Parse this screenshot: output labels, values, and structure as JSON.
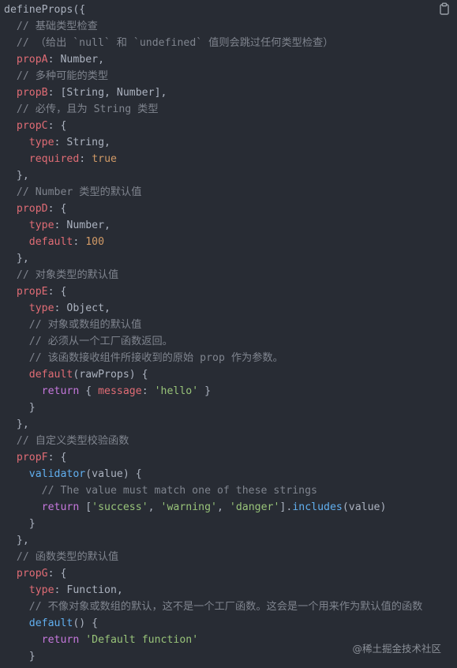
{
  "code": {
    "lines": [
      [
        {
          "t": "defineProps({",
          "c": "d"
        }
      ],
      [
        {
          "t": "  // 基础类型检查",
          "c": "c"
        }
      ],
      [
        {
          "t": "  // （给出 `null` 和 `undefined` 值则会跳过任何类型检查）",
          "c": "c"
        }
      ],
      [
        {
          "t": "  ",
          "c": "d"
        },
        {
          "t": "propA",
          "c": "p"
        },
        {
          "t": ": Number,",
          "c": "d"
        }
      ],
      [
        {
          "t": "  // 多种可能的类型",
          "c": "c"
        }
      ],
      [
        {
          "t": "  ",
          "c": "d"
        },
        {
          "t": "propB",
          "c": "p"
        },
        {
          "t": ": [String, Number],",
          "c": "d"
        }
      ],
      [
        {
          "t": "  // 必传，且为 String 类型",
          "c": "c"
        }
      ],
      [
        {
          "t": "  ",
          "c": "d"
        },
        {
          "t": "propC",
          "c": "p"
        },
        {
          "t": ": {",
          "c": "d"
        }
      ],
      [
        {
          "t": "    ",
          "c": "d"
        },
        {
          "t": "type",
          "c": "p"
        },
        {
          "t": ": String,",
          "c": "d"
        }
      ],
      [
        {
          "t": "    ",
          "c": "d"
        },
        {
          "t": "required",
          "c": "p"
        },
        {
          "t": ": ",
          "c": "d"
        },
        {
          "t": "true",
          "c": "n"
        }
      ],
      [
        {
          "t": "  },",
          "c": "d"
        }
      ],
      [
        {
          "t": "  // Number 类型的默认值",
          "c": "c"
        }
      ],
      [
        {
          "t": "  ",
          "c": "d"
        },
        {
          "t": "propD",
          "c": "p"
        },
        {
          "t": ": {",
          "c": "d"
        }
      ],
      [
        {
          "t": "    ",
          "c": "d"
        },
        {
          "t": "type",
          "c": "p"
        },
        {
          "t": ": Number,",
          "c": "d"
        }
      ],
      [
        {
          "t": "    ",
          "c": "d"
        },
        {
          "t": "default",
          "c": "p"
        },
        {
          "t": ": ",
          "c": "d"
        },
        {
          "t": "100",
          "c": "n"
        }
      ],
      [
        {
          "t": "  },",
          "c": "d"
        }
      ],
      [
        {
          "t": "  // 对象类型的默认值",
          "c": "c"
        }
      ],
      [
        {
          "t": "  ",
          "c": "d"
        },
        {
          "t": "propE",
          "c": "p"
        },
        {
          "t": ": {",
          "c": "d"
        }
      ],
      [
        {
          "t": "    ",
          "c": "d"
        },
        {
          "t": "type",
          "c": "p"
        },
        {
          "t": ": Object,",
          "c": "d"
        }
      ],
      [
        {
          "t": "    // 对象或数组的默认值",
          "c": "c"
        }
      ],
      [
        {
          "t": "    // 必须从一个工厂函数返回。",
          "c": "c"
        }
      ],
      [
        {
          "t": "    // 该函数接收组件所接收到的原始 prop 作为参数。",
          "c": "c"
        }
      ],
      [
        {
          "t": "    ",
          "c": "d"
        },
        {
          "t": "default",
          "c": "p"
        },
        {
          "t": "(rawProps) {",
          "c": "d"
        }
      ],
      [
        {
          "t": "      ",
          "c": "d"
        },
        {
          "t": "return",
          "c": "k"
        },
        {
          "t": " { ",
          "c": "d"
        },
        {
          "t": "message",
          "c": "p"
        },
        {
          "t": ": ",
          "c": "d"
        },
        {
          "t": "'hello'",
          "c": "s"
        },
        {
          "t": " }",
          "c": "d"
        }
      ],
      [
        {
          "t": "    }",
          "c": "d"
        }
      ],
      [
        {
          "t": "  },",
          "c": "d"
        }
      ],
      [
        {
          "t": "  // 自定义类型校验函数",
          "c": "c"
        }
      ],
      [
        {
          "t": "  ",
          "c": "d"
        },
        {
          "t": "propF",
          "c": "p"
        },
        {
          "t": ": {",
          "c": "d"
        }
      ],
      [
        {
          "t": "    ",
          "c": "d"
        },
        {
          "t": "validator",
          "c": "f"
        },
        {
          "t": "(value) {",
          "c": "d"
        }
      ],
      [
        {
          "t": "      // The value must match one of these strings",
          "c": "c"
        }
      ],
      [
        {
          "t": "      ",
          "c": "d"
        },
        {
          "t": "return",
          "c": "k"
        },
        {
          "t": " [",
          "c": "d"
        },
        {
          "t": "'success'",
          "c": "s"
        },
        {
          "t": ", ",
          "c": "d"
        },
        {
          "t": "'warning'",
          "c": "s"
        },
        {
          "t": ", ",
          "c": "d"
        },
        {
          "t": "'danger'",
          "c": "s"
        },
        {
          "t": "].",
          "c": "d"
        },
        {
          "t": "includes",
          "c": "f"
        },
        {
          "t": "(value)",
          "c": "d"
        }
      ],
      [
        {
          "t": "    }",
          "c": "d"
        }
      ],
      [
        {
          "t": "  },",
          "c": "d"
        }
      ],
      [
        {
          "t": "  // 函数类型的默认值",
          "c": "c"
        }
      ],
      [
        {
          "t": "  ",
          "c": "d"
        },
        {
          "t": "propG",
          "c": "p"
        },
        {
          "t": ": {",
          "c": "d"
        }
      ],
      [
        {
          "t": "    ",
          "c": "d"
        },
        {
          "t": "type",
          "c": "p"
        },
        {
          "t": ": Function,",
          "c": "d"
        }
      ],
      [
        {
          "t": "    // 不像对象或数组的默认，这不是一个工厂函数。这会是一个用来作为默认值的函数",
          "c": "c"
        }
      ],
      [
        {
          "t": "    ",
          "c": "d"
        },
        {
          "t": "default",
          "c": "f"
        },
        {
          "t": "() {",
          "c": "d"
        }
      ],
      [
        {
          "t": "      ",
          "c": "d"
        },
        {
          "t": "return",
          "c": "k"
        },
        {
          "t": " ",
          "c": "d"
        },
        {
          "t": "'Default function'",
          "c": "s"
        }
      ],
      [
        {
          "t": "    }",
          "c": "d"
        }
      ],
      [
        {
          "t": "  }",
          "c": "d"
        }
      ]
    ]
  },
  "copy_icon": "clipboard-icon",
  "watermark": "@稀土掘金技术社区",
  "colors": {
    "background": "#282c34",
    "default": "#abb2bf",
    "comment": "#7f848e",
    "property": "#e06c75",
    "keyword": "#c678dd",
    "string": "#98c379",
    "number": "#d19a66",
    "function": "#61afef"
  }
}
